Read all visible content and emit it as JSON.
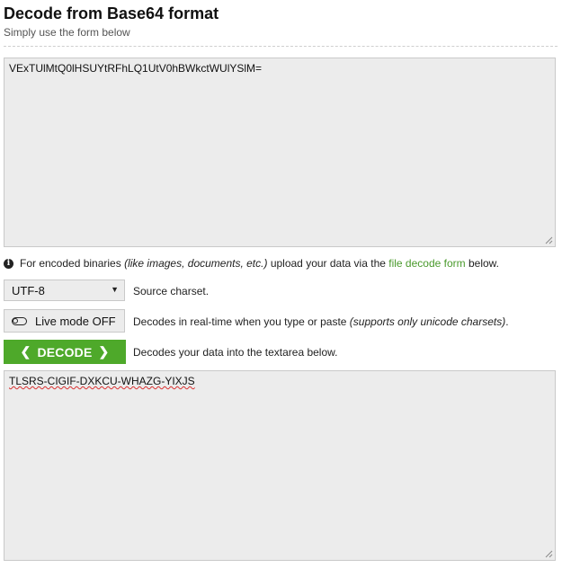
{
  "header": {
    "title": "Decode from Base64 format",
    "subtitle": "Simply use the form below"
  },
  "input": {
    "value": "VExTUlMtQ0lHSUYtRFhLQ1UtV0hBWkctWUlYSlM="
  },
  "info": {
    "icon": "info-icon",
    "text_before": "For encoded binaries ",
    "text_italic": "(like images, documents, etc.)",
    "text_middle": " upload your data via the ",
    "link": "file decode form",
    "text_after": " below."
  },
  "charset": {
    "selected": "UTF-8",
    "description": "Source charset."
  },
  "live_mode": {
    "label": "Live mode OFF",
    "description_before": "Decodes in real-time when you type or paste ",
    "description_italic": "(supports only unicode charsets)",
    "description_after": "."
  },
  "decode": {
    "label": "DECODE",
    "description": "Decodes your data into the textarea below."
  },
  "output": {
    "value": "TLSRS-CIGIF-DXKCU-WHAZG-YIXJS"
  },
  "colors": {
    "accent": "#4ea92a",
    "link": "#4a9a2c",
    "field_bg": "#ececec"
  }
}
